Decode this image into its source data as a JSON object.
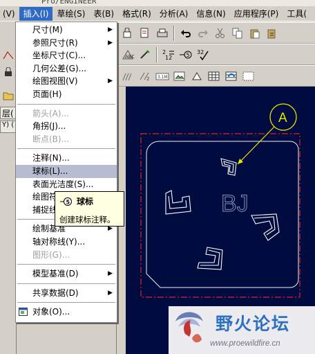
{
  "app": {
    "title_fragment": "Pro/ENGINEER"
  },
  "menubar": {
    "items": [
      {
        "label": "(V)",
        "active": false
      },
      {
        "label": "插入(I)",
        "active": true
      },
      {
        "label": "草绘(S)",
        "active": false
      },
      {
        "label": "表(B)",
        "active": false
      },
      {
        "label": "格式(R)",
        "active": false
      },
      {
        "label": "分析(A)",
        "active": false
      },
      {
        "label": "信息(N)",
        "active": false
      },
      {
        "label": "应用程序(P)",
        "active": false
      },
      {
        "label": "工具(",
        "active": false
      }
    ]
  },
  "left_panel": {
    "layer_tab": "层(",
    "second_tab": "Y) ("
  },
  "dropdown": {
    "items": [
      {
        "label": "尺寸(M)",
        "submenu": true,
        "disabled": false
      },
      {
        "label": "参照尺寸(R)",
        "submenu": true,
        "disabled": false
      },
      {
        "label": "坐标尺寸(C)...",
        "submenu": false,
        "disabled": false
      },
      {
        "label": "几何公差(G)...",
        "submenu": false,
        "disabled": false
      },
      {
        "label": "绘图视图(V)",
        "submenu": true,
        "disabled": false
      },
      {
        "label": "页面(H)",
        "submenu": false,
        "disabled": false
      },
      {
        "separator": true
      },
      {
        "label": "箭头(A)...",
        "submenu": false,
        "disabled": true
      },
      {
        "label": "角拐(J)...",
        "submenu": false,
        "disabled": false
      },
      {
        "label": "断点(B)...",
        "submenu": false,
        "disabled": true
      },
      {
        "separator": true
      },
      {
        "label": "注释(N)...",
        "submenu": false,
        "disabled": false
      },
      {
        "label": "球标(L)...",
        "submenu": false,
        "disabled": false,
        "highlight": true
      },
      {
        "label": "表面光洁度(S)...",
        "submenu": false,
        "disabled": false
      },
      {
        "label": "绘图符",
        "submenu": false,
        "disabled": false
      },
      {
        "label": "捕捉线",
        "submenu": false,
        "disabled": false
      },
      {
        "separator": true
      },
      {
        "label": "绘制基准",
        "submenu": true,
        "disabled": false
      },
      {
        "label": "轴对称线(Y)...",
        "submenu": false,
        "disabled": false
      },
      {
        "label": "图形(G)...",
        "submenu": false,
        "disabled": true
      },
      {
        "separator": true
      },
      {
        "label": "模型基准(D)",
        "submenu": true,
        "disabled": false
      },
      {
        "separator": true
      },
      {
        "label": "共享数据(D)",
        "submenu": true,
        "disabled": false
      },
      {
        "separator": true
      },
      {
        "label": "对象(O)...",
        "submenu": false,
        "disabled": false,
        "icon": "object-icon"
      }
    ]
  },
  "tooltip": {
    "title": "球标",
    "description": "创建球标注释。",
    "icon": "balloon-note-icon"
  },
  "canvas": {
    "balloon_label": "A",
    "center_text": "BJ",
    "colors": {
      "background": "#000b3f",
      "border_dashed": "#e0202a",
      "balloon": "#e6e600",
      "part": "#ffffff"
    }
  },
  "toolbar": {
    "row2_texts": [
      "2\n12",
      "5",
      "32"
    ],
    "icons": [
      "sheet-icon",
      "print-icon",
      "undo-icon",
      "redo-icon",
      "cut-icon",
      "copy-icon",
      "paste-icon"
    ]
  },
  "watermark": {
    "title": "野火论坛",
    "url": "www.proewildfire.cn"
  }
}
